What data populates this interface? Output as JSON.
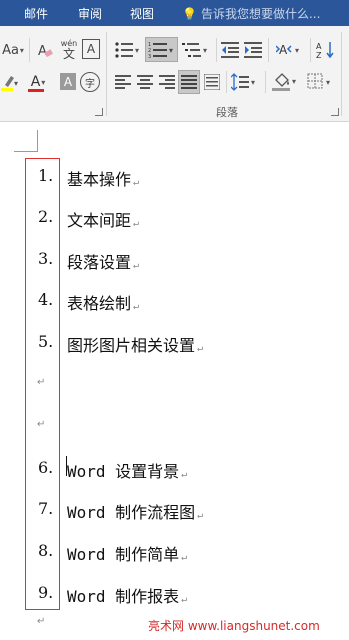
{
  "tabs": [
    "邮件",
    "审阅",
    "视图"
  ],
  "tell_me": "告诉我您想要做什么...",
  "ribbon": {
    "font_size_label": "Aa",
    "wen_label": "wén",
    "wen_char": "文",
    "boxed_a": "A",
    "font_color_a": "A",
    "shade_a": "A",
    "enclose_char": "字",
    "paragraph_group_label": "段落"
  },
  "colors": {
    "tabbar": "#2b579a",
    "numbox_border": "#e03131",
    "watermark": "#d42a2a"
  },
  "list_items": [
    {
      "num": "1.",
      "text": "基本操作"
    },
    {
      "num": "2.",
      "text": "文本间距"
    },
    {
      "num": "3.",
      "text": "段落设置"
    },
    {
      "num": "4.",
      "text": "表格绘制"
    },
    {
      "num": "5.",
      "text": "图形图片相关设置"
    },
    {
      "num": "6.",
      "text": "Word 设置背景"
    },
    {
      "num": "7.",
      "text": "Word 制作流程图"
    },
    {
      "num": "8.",
      "text": "Word 制作简单"
    },
    {
      "num": "9.",
      "text": "Word 制作报表"
    }
  ],
  "paragraph_mark": "↵",
  "watermark": "亮术网 www.liangshunet.com"
}
